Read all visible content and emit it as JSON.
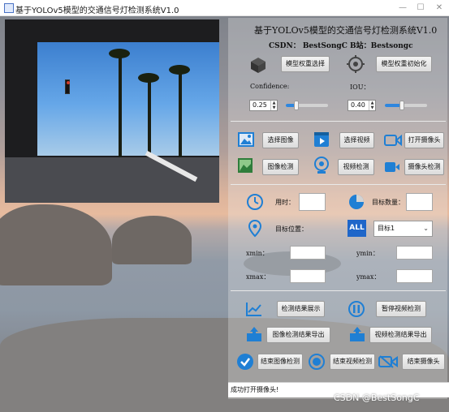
{
  "window": {
    "title": "基于YOLOv5模型的交通信号灯检测系统V1.0"
  },
  "header": {
    "title": "基于YOLOv5模型的交通信号灯检测系统V1.0",
    "credits": "CSDN：  BestSongC    B站：Bestsongc"
  },
  "model": {
    "select_weights": "模型权重选择",
    "init_weights": "模型权重初始化",
    "confidence_label": "Confidence:",
    "confidence_value": "0.25",
    "confidence_slider": 0.25,
    "iou_label": "IOU：",
    "iou_value": "0.40",
    "iou_slider": 0.4
  },
  "media": {
    "select_image": "选择图像",
    "select_video": "选择视频",
    "open_camera": "打开摄像头",
    "image_detect": "图像检测",
    "video_detect": "视频检测",
    "camera_detect": "摄像头检测"
  },
  "stats": {
    "time_label": "用时：",
    "time_value": "",
    "count_label": "目标数量：",
    "count_value": "",
    "position_label": "目标位置：",
    "target_select": "目标1",
    "xmin_label": "xmin：",
    "ymin_label": "ymin：",
    "xmax_label": "xmax：",
    "ymax_label": "ymax："
  },
  "actions": {
    "show_results": "检测结果展示",
    "pause_video": "暂停视频检测",
    "export_image_results": "图像检测结果导出",
    "export_video_results": "视频检测结果导出",
    "end_image_detect": "结束图像检测",
    "end_video_detect": "结束视频检测",
    "end_camera": "结束摄像头"
  },
  "status": {
    "message": "成功打开摄像头!"
  },
  "watermark": "CSDN @BestSongC",
  "colors": {
    "accent": "#2e86de",
    "icon_blue": "#1f7fd4",
    "panel_sep": "#e9e9e9"
  }
}
